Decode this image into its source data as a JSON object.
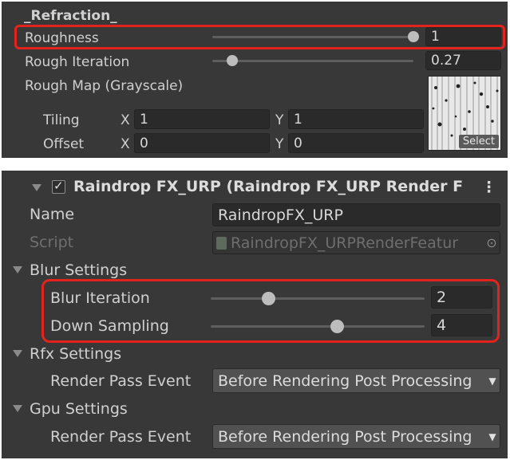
{
  "refraction": {
    "header": "_Refraction_",
    "roughness": {
      "label": "Roughness",
      "value": "1",
      "slider": 1.0
    },
    "rough_iteration": {
      "label": "Rough Iteration",
      "value": "0.27",
      "slider": 0.1
    },
    "rough_map": {
      "label": "Rough Map (Grayscale)",
      "select_label": "Select"
    },
    "tiling": {
      "label": "Tiling",
      "x_label": "X",
      "x_value": "1",
      "y_label": "Y",
      "y_value": "1"
    },
    "offset": {
      "label": "Offset",
      "x_label": "X",
      "x_value": "0",
      "y_label": "Y",
      "y_value": "0"
    }
  },
  "feature": {
    "title": "Raindrop FX_URP (Raindrop FX_URP Render F",
    "more_icon": "kebab-menu-icon",
    "name_label": "Name",
    "name_value": "RaindropFX_URP",
    "script_label": "Script",
    "script_value": "RaindropFX_URPRenderFeatur",
    "blur_settings": {
      "label": "Blur Settings",
      "blur_iteration": {
        "label": "Blur Iteration",
        "value": "2",
        "slider": 0.27
      },
      "down_sampling": {
        "label": "Down Sampling",
        "value": "4",
        "slider": 0.59
      }
    },
    "rfx_settings": {
      "label": "Rfx Settings",
      "render_pass_event_label": "Render Pass Event",
      "render_pass_event_value": "Before Rendering Post Processing"
    },
    "gpu_settings": {
      "label": "Gpu Settings",
      "render_pass_event_label": "Render Pass Event",
      "render_pass_event_value": "Before Rendering Post Processing"
    }
  },
  "colors": {
    "highlight": "#e3231c",
    "panel": "#383838",
    "field": "#2a2a2a"
  }
}
